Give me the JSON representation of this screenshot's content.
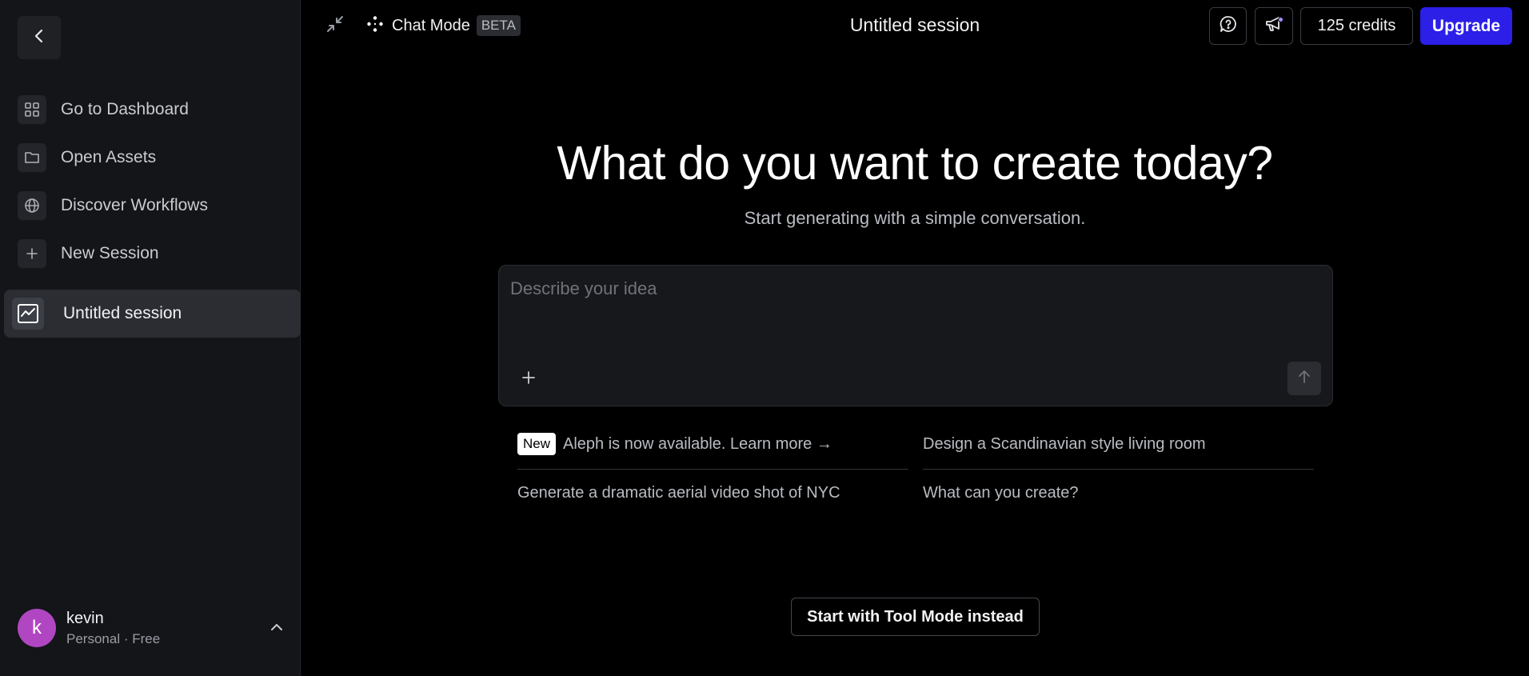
{
  "sidebar": {
    "nav": [
      {
        "label": "Go to Dashboard",
        "icon": "grid-icon"
      },
      {
        "label": "Open Assets",
        "icon": "folder-icon"
      },
      {
        "label": "Discover Workflows",
        "icon": "globe-icon"
      },
      {
        "label": "New Session",
        "icon": "plus-icon"
      }
    ],
    "session": {
      "label": "Untitled session",
      "icon": "chart-line-icon"
    },
    "user": {
      "initial": "k",
      "name": "kevin",
      "plan": "Personal · Free",
      "avatar_color": "#b146c2"
    }
  },
  "header": {
    "mode_label": "Chat Mode",
    "beta_label": "BETA",
    "title": "Untitled session",
    "credits": "125 credits",
    "upgrade_label": "Upgrade",
    "accent": "#2b1fe8"
  },
  "main": {
    "headline": "What do you want to create today?",
    "subhead": "Start generating with a simple conversation.",
    "composer": {
      "placeholder": "Describe your idea",
      "value": ""
    },
    "suggestions": {
      "new_badge": "New",
      "announcement": "Aleph is now available. Learn more →",
      "s1": "Design a Scandinavian style living room",
      "s2": "Generate a dramatic aerial video shot of NYC",
      "s3": "What can you create?"
    },
    "tool_mode_label": "Start with Tool Mode instead"
  }
}
